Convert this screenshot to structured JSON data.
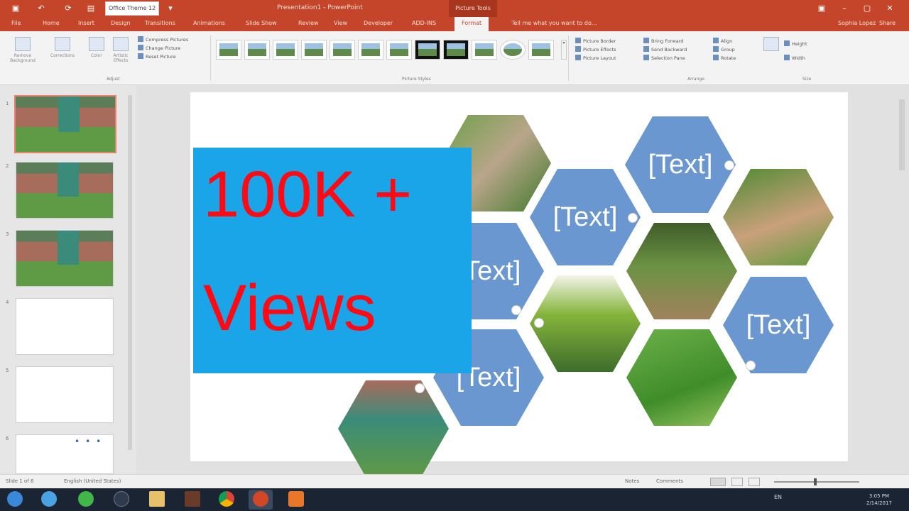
{
  "window": {
    "title": "Presentation1 - PowerPoint",
    "name_box": "Office Theme 12",
    "contextual_tab": "Picture Tools",
    "user": "Sophia Lopez",
    "share_label": "Share"
  },
  "tabs": [
    "File",
    "Home",
    "Insert",
    "Design",
    "Transitions",
    "Animations",
    "Slide Show",
    "Review",
    "View",
    "Developer",
    "ADD-INS",
    "Format"
  ],
  "tell_me": "Tell me what you want to do...",
  "ribbon": {
    "adjust_buttons": [
      "Remove Background",
      "Corrections",
      "Color",
      "Artistic Effects"
    ],
    "adjust_small": [
      "Compress Pictures",
      "Change Picture",
      "Reset Picture"
    ],
    "picture_style_count": 12,
    "arrange_small": [
      "Picture Border",
      "Picture Effects",
      "Picture Layout"
    ],
    "order_small": [
      "Bring Forward",
      "Send Backward",
      "Selection Pane"
    ],
    "align_small": [
      "Align",
      "Group",
      "Rotate"
    ],
    "size_fields": [
      "Height",
      "Width"
    ],
    "group_labels": [
      "Adjust",
      "Picture Styles",
      "Arrange",
      "Size"
    ]
  },
  "slide_panel": {
    "numbers": [
      "1",
      "2",
      "3",
      "4",
      "5",
      "6"
    ],
    "selected": 1
  },
  "slide": {
    "placeholders": [
      "[Text]",
      "[Text]",
      "[Text]",
      "[Text]",
      "[Text]"
    ],
    "hexagons_pictures": 6
  },
  "banner": {
    "line1": "100K +",
    "line2": "Views",
    "bg_color": "#1aa5e8",
    "text_color": "#ff0a14"
  },
  "status": {
    "slide_info": "Slide 1 of 6",
    "language": "English (United States)",
    "notes": "Notes",
    "comments": "Comments"
  },
  "taskbar": {
    "tray": "EN",
    "time": "3:05 PM",
    "date": "2/14/2017"
  },
  "colors": {
    "accent": "#c4452a",
    "placeholder_hex": "#6a97cf"
  }
}
